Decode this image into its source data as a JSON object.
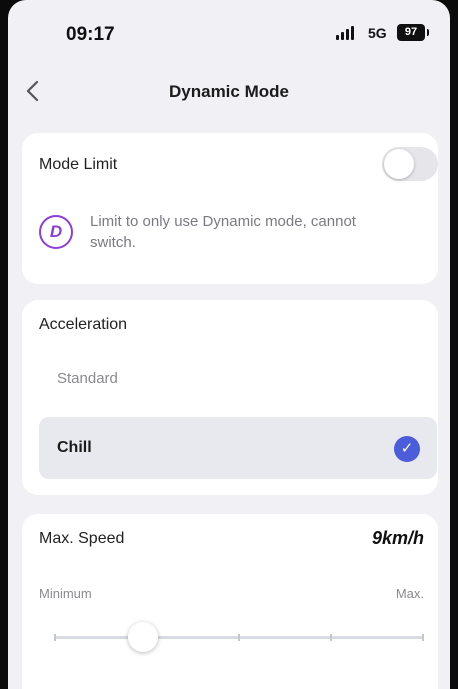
{
  "status_bar": {
    "time": "09:17",
    "network": "5G",
    "battery": "97"
  },
  "nav": {
    "title": "Dynamic Mode",
    "back_icon": "chevron-left-icon"
  },
  "mode_limit": {
    "label": "Mode Limit",
    "enabled": false,
    "description": "Limit to only use Dynamic mode, cannot switch.",
    "icon": "dynamic-mode-icon",
    "icon_letter": "D",
    "icon_color": "#8b3fd6"
  },
  "acceleration": {
    "title": "Acceleration",
    "options": [
      "Standard",
      "Chill"
    ],
    "selected": "Chill",
    "check_icon": "checkmark-icon",
    "accent_color": "#4c5ddb"
  },
  "max_speed": {
    "title": "Max. Speed",
    "value": "9km/h",
    "min_label": "Minimum",
    "max_label": "Max.",
    "slider": {
      "steps": 5,
      "position_fraction": 0.24
    }
  }
}
